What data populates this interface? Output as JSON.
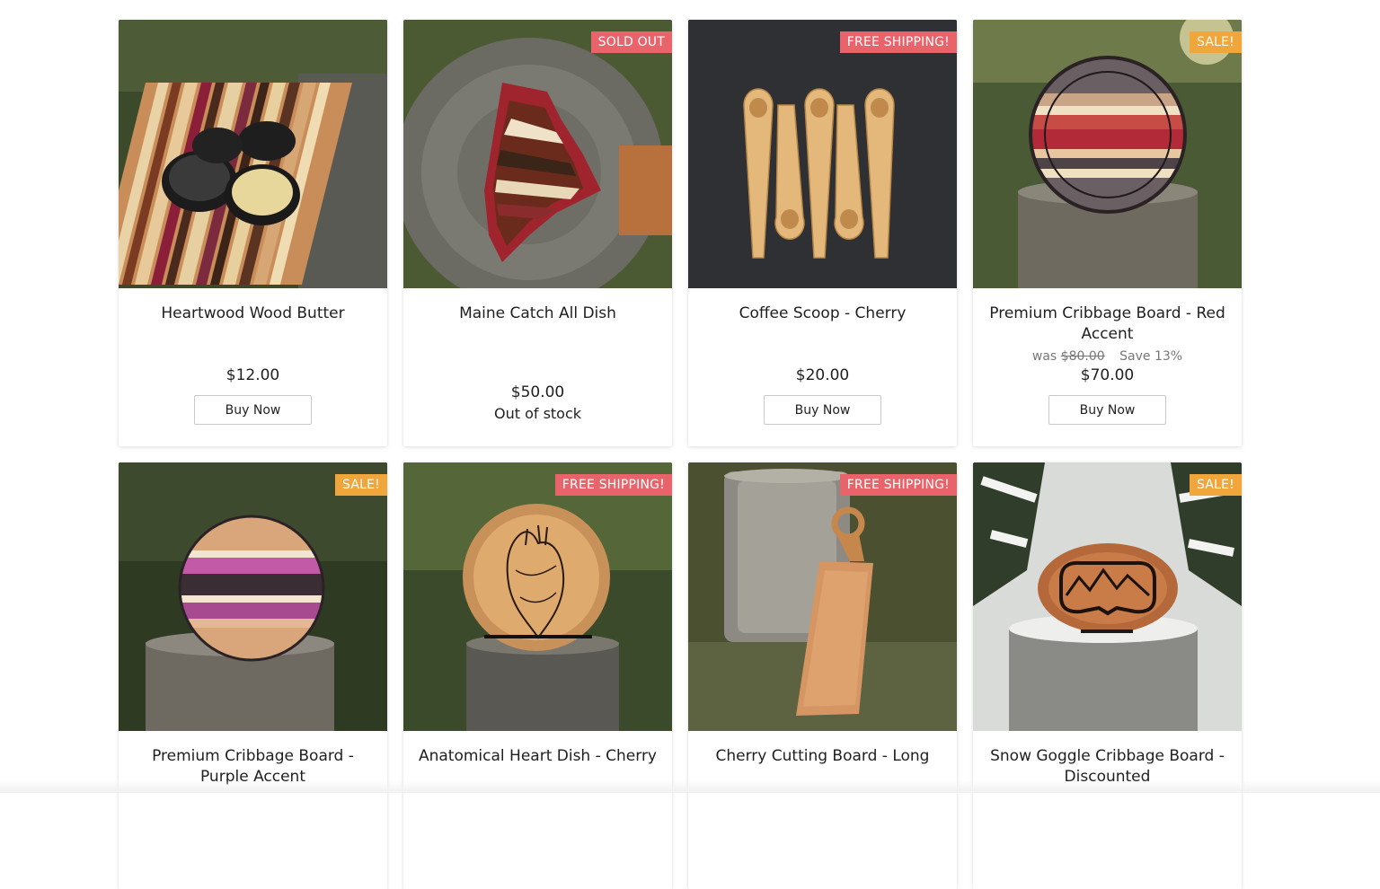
{
  "products": [
    {
      "title": "Heartwood Wood Butter",
      "price": "$12.00",
      "button": "Buy Now"
    },
    {
      "title": "Maine Catch All Dish",
      "badge": "SOLD OUT",
      "price": "$50.00",
      "stock": "Out of stock"
    },
    {
      "title": "Coffee Scoop - Cherry",
      "badge": "FREE SHIPPING!",
      "price": "$20.00",
      "button": "Buy Now"
    },
    {
      "title": "Premium Cribbage Board - Red Accent",
      "badge": "SALE!",
      "was_label": "was",
      "was_price": "$80.00",
      "save": "Save 13%",
      "price": "$70.00",
      "button": "Buy Now"
    },
    {
      "title": "Premium Cribbage Board - Purple Accent",
      "badge": "SALE!"
    },
    {
      "title": "Anatomical Heart Dish - Cherry",
      "badge": "FREE SHIPPING!"
    },
    {
      "title": "Cherry Cutting Board - Long",
      "badge": "FREE SHIPPING!"
    },
    {
      "title": "Snow Goggle Cribbage Board - Discounted",
      "badge": "SALE!"
    }
  ],
  "colors": {
    "badge_red": "#e9636b",
    "badge_orange": "#f0a63a"
  }
}
